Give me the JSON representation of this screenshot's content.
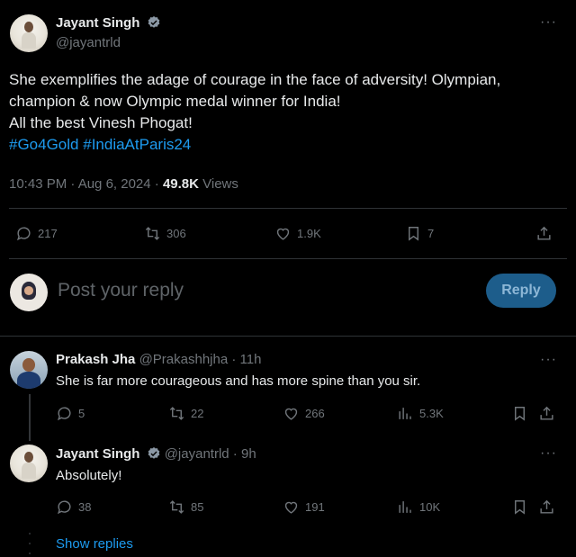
{
  "main_tweet": {
    "author_name": "Jayant Singh",
    "handle": "@jayantrld",
    "text_line1": "She exemplifies the adage of courage in the face of adversity! Olympian,",
    "text_line2": "champion & now Olympic medal winner for India!",
    "text_line3": "All the best Vinesh Phogat!",
    "hashtag1": "#Go4Gold",
    "hashtag2": "#IndiaAtParis24",
    "timestamp": "10:43 PM · Aug 6, 2024 · ",
    "views_count": "49.8K",
    "views_label": " Views",
    "replies": "217",
    "reposts": "306",
    "likes": "1.9K",
    "bookmarks": "7",
    "more": "···"
  },
  "reply_box": {
    "placeholder": "Post your reply",
    "button_label": "Reply"
  },
  "replies": [
    {
      "author_name": "Prakash Jha",
      "handle": "@Prakashhjha",
      "time": " · 11h",
      "text": "She is far more courageous and has more spine than you sir.",
      "replies": "5",
      "reposts": "22",
      "likes": "266",
      "views": "5.3K",
      "more": "···"
    },
    {
      "author_name": "Jayant Singh",
      "handle": "@jayantrld",
      "time": " · 9h",
      "text": "Absolutely!",
      "replies": "38",
      "reposts": "85",
      "likes": "191",
      "views": "10K",
      "more": "···"
    }
  ],
  "show_replies": "Show replies",
  "colors": {
    "accent": "#1d9bf0",
    "muted": "#71767b",
    "background": "#000000"
  },
  "icons": [
    "verified-badge-icon",
    "reply-icon",
    "repost-icon",
    "like-icon",
    "bookmark-icon",
    "share-icon",
    "views-icon",
    "more-icon"
  ]
}
